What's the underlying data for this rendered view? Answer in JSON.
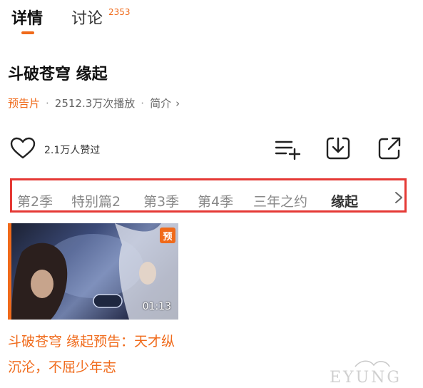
{
  "tabs": [
    {
      "label": "详情",
      "active": true
    },
    {
      "label": "讨论",
      "count": "2353",
      "active": false
    }
  ],
  "title": "斗破苍穹 缘起",
  "meta": {
    "type_label": "预告片",
    "plays": "2512.3万次播放",
    "intro_label": "简介"
  },
  "like": {
    "text": "2.1万人赞过",
    "icon": "heart-outline-icon"
  },
  "actions": [
    {
      "name": "add-to-list-icon"
    },
    {
      "name": "download-icon"
    },
    {
      "name": "share-icon"
    }
  ],
  "seasons": [
    "第2季",
    "特别篇2",
    "第3季",
    "第4季",
    "三年之约",
    "缘起"
  ],
  "active_season": "缘起",
  "video": {
    "badge": "预",
    "duration": "01:13",
    "title": "斗破苍穹 缘起预告：天才纵沉沦，不屈少年志"
  },
  "watermark": "EYUNG",
  "colors": {
    "accent": "#f06a1a",
    "highlight_box": "#e53935"
  }
}
